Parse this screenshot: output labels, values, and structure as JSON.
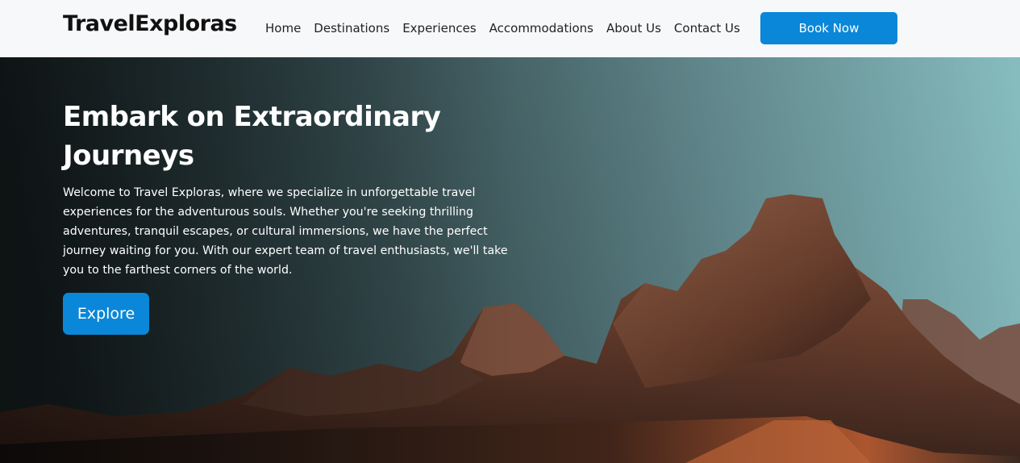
{
  "brand": {
    "name": "TravelExploras"
  },
  "nav": {
    "links": [
      {
        "label": "Home"
      },
      {
        "label": "Destinations"
      },
      {
        "label": "Experiences"
      },
      {
        "label": "Accommodations"
      },
      {
        "label": "About Us"
      },
      {
        "label": "Contact Us"
      }
    ],
    "cta_label": "Book Now"
  },
  "hero": {
    "title_line1": "Embark on Extraordinary",
    "title_line2": "Journeys",
    "description": "Welcome to Travel Exploras, where we specialize in unforgettable travel experiences for the adventurous souls. Whether you're seeking thrilling adventures, tranquil escapes, or cultural immersions, we have the perfect journey waiting for you. With our expert team of travel enthusiasts, we'll take you to the farthest corners of the world.",
    "button_label": "Explore",
    "background_image": "mountain-landscape"
  },
  "colors": {
    "accent": "#0a87d8",
    "navbar_bg": "#f7f8fa",
    "text_dark": "#111111",
    "text_light": "#ffffff"
  }
}
